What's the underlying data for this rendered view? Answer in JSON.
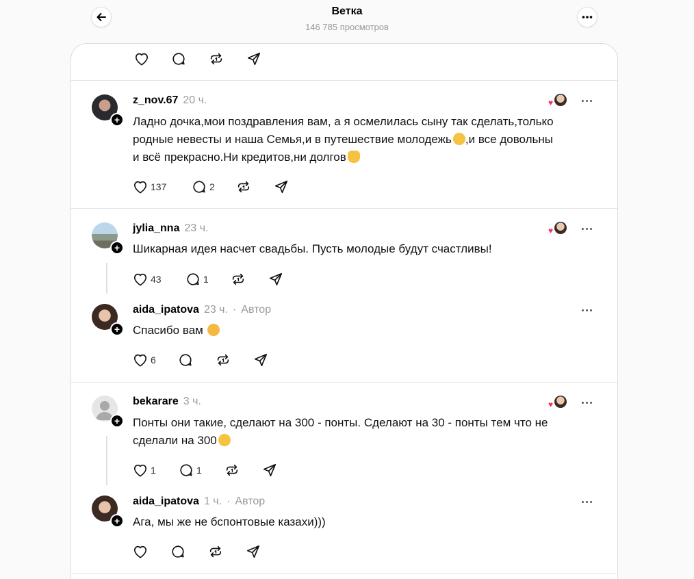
{
  "header": {
    "title": "Ветка",
    "views": "146 785 просмотров"
  },
  "top_actions": {},
  "comments": [
    {
      "username": "z_nov.67",
      "time": "20 ч.",
      "text_lines": [
        "Ладно дочка,мои поздравления вам, а я осмелилась сыну так сделать,только",
        "родные невесты и наша Семья,и в путешествие молодежь",
        ",и все довольны",
        "и всё прекрасно.Ни кредитов,ни долгов"
      ],
      "likes": "137",
      "replies": "2"
    },
    {
      "username": "jylia_nna",
      "time": "23 ч.",
      "text": "Шикарная идея насчет свадьбы. Пусть молодые будут счастливы!",
      "likes": "43",
      "replies": "1"
    },
    {
      "username": "aida_ipatova",
      "time": "23 ч.",
      "separator": "·",
      "author_label": "Автор",
      "text": "Спасибо вам",
      "likes": "6"
    },
    {
      "username": "bekarare",
      "time": "3 ч.",
      "text_lines": [
        "Понты они такие, сделают на 300 - понты. Сделают на 30 - понты тем что не",
        "сделали на 300"
      ],
      "likes": "1",
      "replies": "1"
    },
    {
      "username": "aida_ipatova",
      "time": "1 ч.",
      "separator": "·",
      "author_label": "Автор",
      "text": "Ага, мы же не бспонтовые казахи)))"
    }
  ],
  "icons": {
    "back": "arrow-left-icon",
    "more": "more-horizontal-icon",
    "like": "heart-icon",
    "reply": "comment-bubble-icon",
    "repost": "repost-icon",
    "share": "send-icon",
    "follow": "plus-icon"
  },
  "colors": {
    "like_heart": "#ff2d55",
    "muted_text": "#999999",
    "divider": "#e4e4e4"
  }
}
